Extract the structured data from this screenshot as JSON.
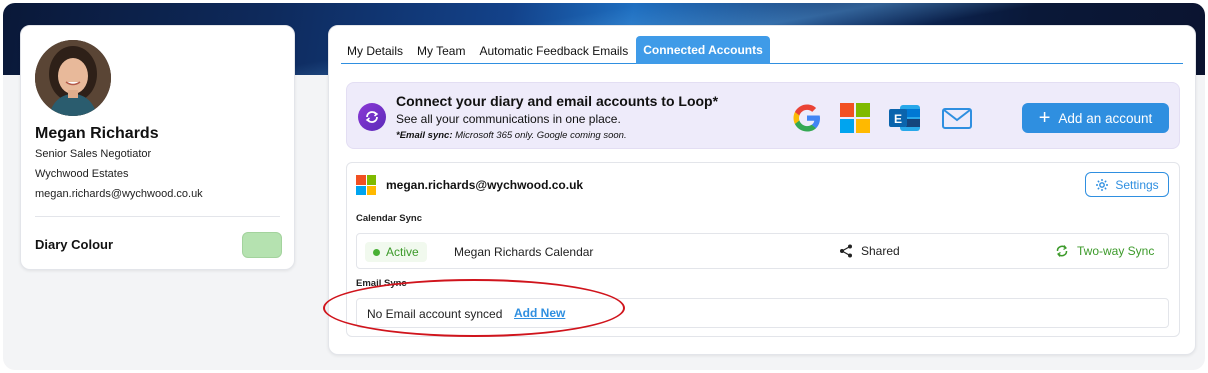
{
  "profile": {
    "name": "Megan Richards",
    "title": "Senior Sales Negotiator",
    "company": "Wychwood Estates",
    "email": "megan.richards@wychwood.co.uk",
    "diary_colour_label": "Diary Colour",
    "diary_colour": "#b5e2b0"
  },
  "tabs": [
    {
      "label": "My Details",
      "active": false
    },
    {
      "label": "My Team",
      "active": false
    },
    {
      "label": "Automatic Feedback Emails",
      "active": false
    },
    {
      "label": "Connected Accounts",
      "active": true
    }
  ],
  "connect": {
    "title": "Connect your diary and email accounts to Loop*",
    "subtitle": "See all your communications in one place.",
    "note_bold": "*Email sync:",
    "note_rest": " Microsoft 365 only. Google coming soon.",
    "providers": [
      "google-icon",
      "microsoft-icon",
      "exchange-icon",
      "email-icon"
    ],
    "add_button": "Add an account"
  },
  "account": {
    "email": "megan.richards@wychwood.co.uk",
    "settings_label": "Settings",
    "calendar_sync_label": "Calendar Sync",
    "calendar": {
      "status": "Active",
      "name": "Megan Richards Calendar",
      "sharing": "Shared",
      "sync_mode": "Two-way Sync"
    },
    "email_sync_label": "Email Sync",
    "email_sync": {
      "empty_text": "No Email account synced",
      "add_link": "Add New"
    }
  },
  "colors": {
    "accent": "#2f8fe0",
    "active_green": "#3c9a2a",
    "highlight_red": "#d0141c"
  }
}
